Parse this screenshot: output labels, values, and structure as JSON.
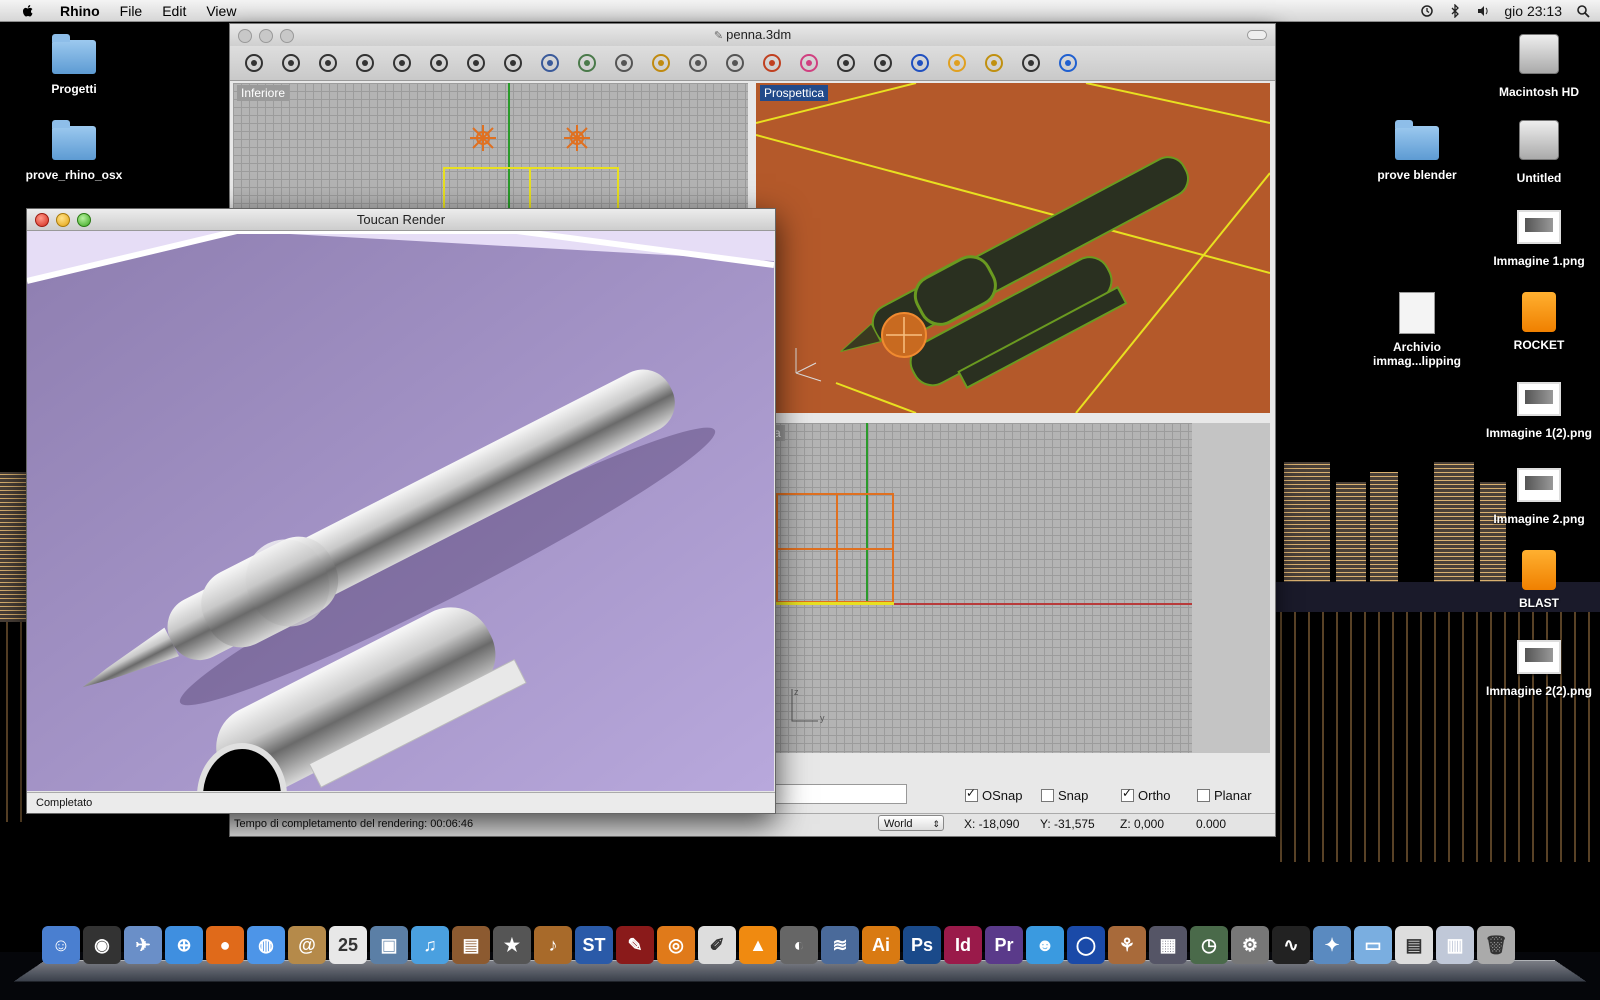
{
  "menubar": {
    "app_name": "Rhino",
    "items": [
      "File",
      "Edit",
      "View"
    ],
    "clock": "gio 23:13"
  },
  "desktop": {
    "left_icons": [
      {
        "label": "Progetti",
        "icon": "folder-icon"
      },
      {
        "label": "prove_rhino_osx",
        "icon": "folder-icon"
      }
    ],
    "right_icons": [
      {
        "label": "Macintosh HD",
        "icon": "hard-drive-icon"
      },
      {
        "label": "prove blender",
        "icon": "folder-icon"
      },
      {
        "label": "Untitled",
        "icon": "hard-drive-icon"
      },
      {
        "label": "Immagine 1.png",
        "icon": "png-file-icon"
      },
      {
        "label": "Archivio immag...lipping",
        "icon": "clipping-file-icon"
      },
      {
        "label": "ROCKET",
        "icon": "usb-drive-icon"
      },
      {
        "label": "Immagine 1(2).png",
        "icon": "png-file-icon"
      },
      {
        "label": "Immagine 2.png",
        "icon": "png-file-icon"
      },
      {
        "label": "BLAST",
        "icon": "usb-drive-icon"
      },
      {
        "label": "Immagine 2(2).png",
        "icon": "png-file-icon"
      }
    ]
  },
  "rhino_window": {
    "title": "penna.3dm",
    "toolbar_icons": [
      "hand-pan-icon",
      "rotate-view-icon",
      "zoom-icon",
      "zoom-window-icon",
      "zoom-extents-icon",
      "zoom-selected-icon",
      "undo-view-icon",
      "four-viewports-icon",
      "car-shaded-icon",
      "grid-plane-icon",
      "osnap-icon",
      "gumball-icon",
      "light-bulb-icon",
      "lock-icon",
      "layer-icon",
      "color-wheel-icon",
      "sphere-wire-icon",
      "sphere-mesh-icon",
      "render-sphere-icon",
      "select-icon",
      "gear-icon",
      "dimension-icon",
      "help-icon"
    ],
    "viewports": {
      "top_left": "Inferiore",
      "top_right": "Prospettica",
      "bottom_right": "estra"
    },
    "status_text": "Tempo di completamento del rendering: 00:06:46",
    "checkboxes": [
      {
        "label": "OSnap",
        "checked": true
      },
      {
        "label": "Snap",
        "checked": false
      },
      {
        "label": "Ortho",
        "checked": true
      },
      {
        "label": "Planar",
        "checked": false
      }
    ],
    "cplane": "World",
    "coords": {
      "x": "X: -18,090",
      "y": "Y: -31,575",
      "z": "Z: 0,000",
      "extra": "0.000"
    }
  },
  "toucan_window": {
    "title": "Toucan Render",
    "status": "Completato"
  },
  "dock": {
    "apps": [
      {
        "name": "finder-icon",
        "color": "#4a7fd0",
        "glyph": "☺"
      },
      {
        "name": "dashboard-icon",
        "color": "#333",
        "glyph": "◉"
      },
      {
        "name": "mail-icon",
        "color": "#6a8fc8",
        "glyph": "✈"
      },
      {
        "name": "safari-icon",
        "color": "#3f8fe0",
        "glyph": "⊕"
      },
      {
        "name": "firefox-icon",
        "color": "#e06a1a",
        "glyph": "●"
      },
      {
        "name": "ichat-icon",
        "color": "#4d95e8",
        "glyph": "◍"
      },
      {
        "name": "address-book-icon",
        "color": "#b58a4a",
        "glyph": "@"
      },
      {
        "name": "ical-icon",
        "color": "#e8e8e8",
        "glyph": "25"
      },
      {
        "name": "iphoto-icon",
        "color": "#5b7fa6",
        "glyph": "▣"
      },
      {
        "name": "itunes-icon",
        "color": "#4aa0e0",
        "glyph": "♫"
      },
      {
        "name": "photo-booth-icon",
        "color": "#8c5a30",
        "glyph": "▤"
      },
      {
        "name": "imovie-icon",
        "color": "#555",
        "glyph": "★"
      },
      {
        "name": "garageband-icon",
        "color": "#a86a2a",
        "glyph": "♪"
      },
      {
        "name": "st-design-icon",
        "color": "#2a5aa8",
        "glyph": "ST"
      },
      {
        "name": "rhino-app-icon",
        "color": "#8a1a1a",
        "glyph": "✎"
      },
      {
        "name": "blender-icon",
        "color": "#e07a1a",
        "glyph": "◎"
      },
      {
        "name": "script-editor-icon",
        "color": "#ddd",
        "glyph": "✐"
      },
      {
        "name": "vlc-icon",
        "color": "#f08a10",
        "glyph": "▲"
      },
      {
        "name": "aperture-icon",
        "color": "#666",
        "glyph": "◐"
      },
      {
        "name": "neooffice-icon",
        "color": "#4a6a9a",
        "glyph": "≋"
      },
      {
        "name": "illustrator-icon",
        "color": "#d97a12",
        "glyph": "Ai"
      },
      {
        "name": "photoshop-icon",
        "color": "#1a4a8a",
        "glyph": "Ps"
      },
      {
        "name": "indesign-icon",
        "color": "#9a1a4a",
        "glyph": "Id"
      },
      {
        "name": "premiere-icon",
        "color": "#5a3a8a",
        "glyph": "Pr"
      },
      {
        "name": "messenger-icon",
        "color": "#3a9ae0",
        "glyph": "☻"
      },
      {
        "name": "google-earth-icon",
        "color": "#1a4aa8",
        "glyph": "◯"
      },
      {
        "name": "transmission-icon",
        "color": "#a86a3a",
        "glyph": "⚘"
      },
      {
        "name": "expose-icon",
        "color": "#556",
        "glyph": "▦"
      },
      {
        "name": "time-machine-icon",
        "color": "#4a6a4a",
        "glyph": "◷"
      },
      {
        "name": "system-preferences-icon",
        "color": "#777",
        "glyph": "⚙"
      },
      {
        "name": "activity-monitor-icon",
        "color": "#222",
        "glyph": "∿"
      },
      {
        "name": "network-utility-icon",
        "color": "#5a8ac0",
        "glyph": "✦"
      },
      {
        "name": "stack-folder-icon",
        "color": "#7aaee0",
        "glyph": "▭"
      },
      {
        "name": "documents-stack-icon",
        "color": "#ddd",
        "glyph": "▤"
      },
      {
        "name": "downloads-stack-icon",
        "color": "#c0c8d8",
        "glyph": "▥"
      },
      {
        "name": "trash-icon",
        "color": "#aaa",
        "glyph": "🗑"
      }
    ]
  }
}
